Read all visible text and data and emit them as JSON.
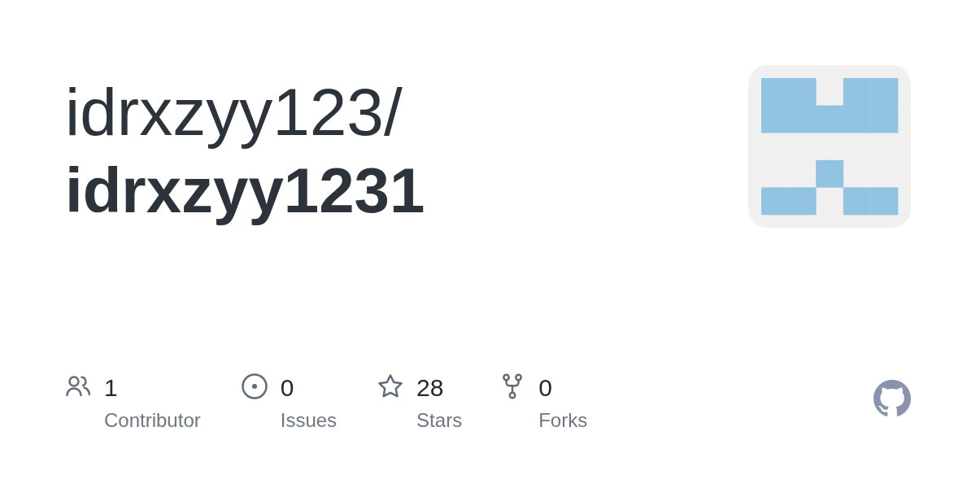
{
  "title": {
    "owner": "idrxzyy123/",
    "repository": "idrxzyy1231"
  },
  "stats": [
    {
      "kind": "contributors",
      "count": "1",
      "label": "Contributor"
    },
    {
      "kind": "issues",
      "count": "0",
      "label": "Issues"
    },
    {
      "kind": "stars",
      "count": "28",
      "label": "Stars"
    },
    {
      "kind": "forks",
      "count": "0",
      "label": "Forks"
    }
  ]
}
